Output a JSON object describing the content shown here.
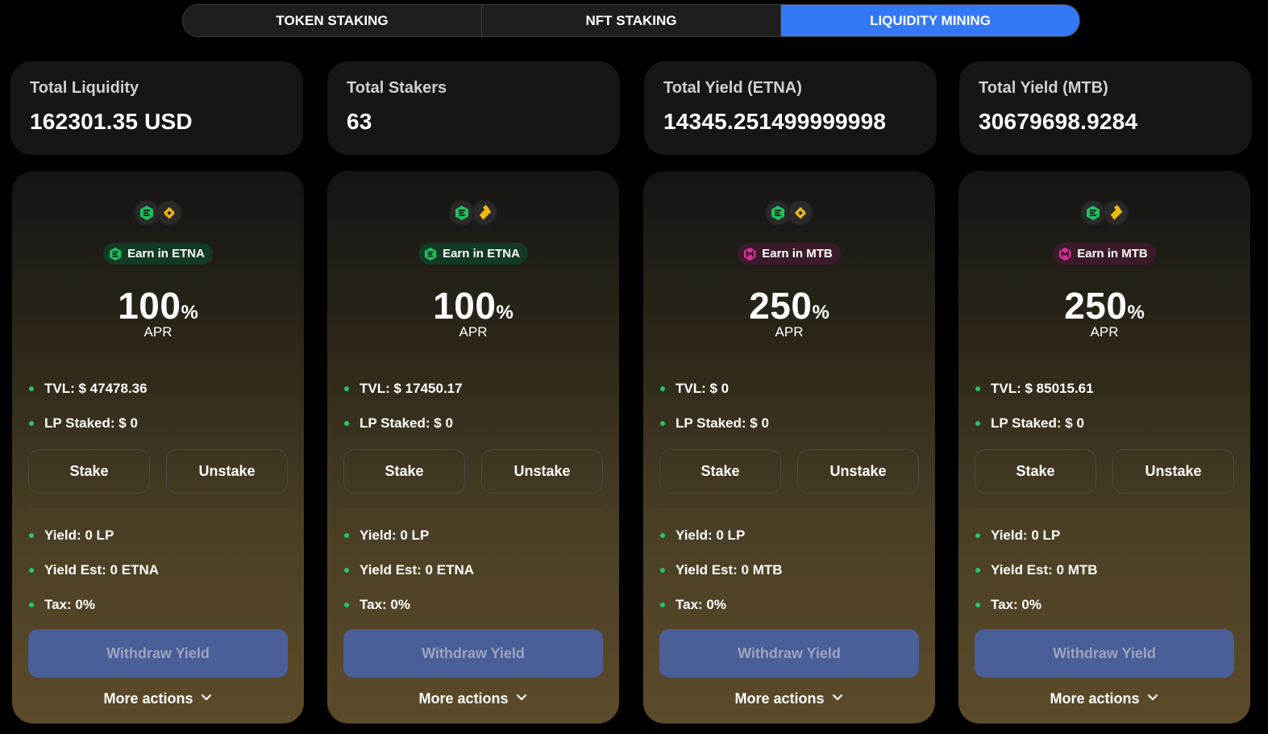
{
  "tabs": [
    {
      "label": "TOKEN STAKING",
      "active": false
    },
    {
      "label": "NFT STAKING",
      "active": false
    },
    {
      "label": "LIQUIDITY MINING",
      "active": true
    }
  ],
  "stats": [
    {
      "label": "Total Liquidity",
      "value": "162301.35 USD"
    },
    {
      "label": "Total Stakers",
      "value": "63"
    },
    {
      "label": "Total Yield (ETNA)",
      "value": "14345.251499999998"
    },
    {
      "label": "Total Yield (MTB)",
      "value": "30679698.9284"
    }
  ],
  "pools": [
    {
      "pair_icons": [
        "etna-icon",
        "bnb-icon"
      ],
      "earn": "Earn in ETNA",
      "earn_icon": "etna-icon",
      "apr_value": "100",
      "apr_pct": "%",
      "apr_label": "APR",
      "tvl": "TVL: $ 47478.36",
      "lp_staked": "LP Staked: $ 0",
      "stake_label": "Stake",
      "unstake_label": "Unstake",
      "yield": "Yield: 0 LP",
      "yield_est": "Yield Est: 0 ETNA",
      "tax": "Tax: 0%",
      "withdraw_label": "Withdraw Yield",
      "more_label": "More actions"
    },
    {
      "pair_icons": [
        "etna-icon",
        "busd-icon"
      ],
      "earn": "Earn in ETNA",
      "earn_icon": "etna-icon",
      "apr_value": "100",
      "apr_pct": "%",
      "apr_label": "APR",
      "tvl": "TVL: $ 17450.17",
      "lp_staked": "LP Staked: $ 0",
      "stake_label": "Stake",
      "unstake_label": "Unstake",
      "yield": "Yield: 0 LP",
      "yield_est": "Yield Est: 0 ETNA",
      "tax": "Tax: 0%",
      "withdraw_label": "Withdraw Yield",
      "more_label": "More actions"
    },
    {
      "pair_icons": [
        "etna-icon",
        "bnb-icon"
      ],
      "earn": "Earn in MTB",
      "earn_icon": "mtb-icon",
      "apr_value": "250",
      "apr_pct": "%",
      "apr_label": "APR",
      "tvl": "TVL: $ 0",
      "lp_staked": "LP Staked: $ 0",
      "stake_label": "Stake",
      "unstake_label": "Unstake",
      "yield": "Yield: 0 LP",
      "yield_est": "Yield Est: 0 MTB",
      "tax": "Tax: 0%",
      "withdraw_label": "Withdraw Yield",
      "more_label": "More actions"
    },
    {
      "pair_icons": [
        "etna-icon",
        "busd-icon"
      ],
      "earn": "Earn in MTB",
      "earn_icon": "mtb-icon",
      "apr_value": "250",
      "apr_pct": "%",
      "apr_label": "APR",
      "tvl": "TVL: $ 85015.61",
      "lp_staked": "LP Staked: $ 0",
      "stake_label": "Stake",
      "unstake_label": "Unstake",
      "yield": "Yield: 0 LP",
      "yield_est": "Yield Est: 0 MTB",
      "tax": "Tax: 0%",
      "withdraw_label": "Withdraw Yield",
      "more_label": "More actions"
    }
  ],
  "colors": {
    "accent": "#3478f6",
    "bullet": "#21c96b",
    "withdraw_bg": "#4a5e97",
    "etna": "#1fbf5f",
    "bnb": "#f0b90b",
    "mtb": "#d6309a"
  }
}
